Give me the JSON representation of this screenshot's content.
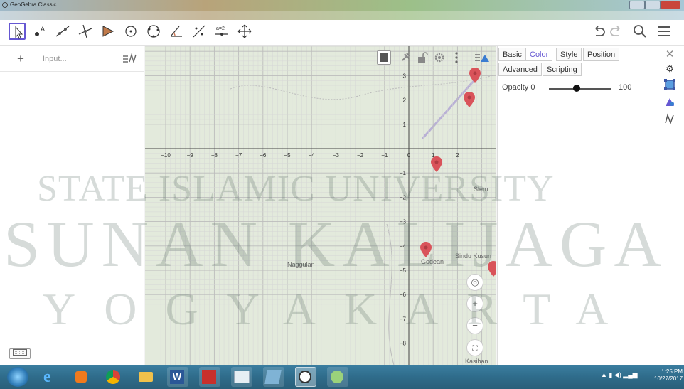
{
  "window": {
    "title": "GeoGebra Classic"
  },
  "toolbar": {
    "tools": [
      "move-tool",
      "point-tool",
      "line-tool",
      "perpendicular-line-tool",
      "polygon-tool",
      "circle-tool",
      "ellipse-tool",
      "angle-tool",
      "reflect-tool",
      "slider-tool",
      "move-graphics-tool"
    ],
    "slider_text": "a=2"
  },
  "algebra": {
    "plus": "+",
    "input_placeholder": "Input..."
  },
  "graphics": {
    "x_ticks": [
      "−10",
      "−9",
      "−8",
      "−7",
      "−6",
      "−5",
      "−4",
      "−3",
      "−2",
      "−1",
      "0",
      "1",
      "2"
    ],
    "y_ticks": [
      "3",
      "2",
      "1",
      "−1",
      "−2",
      "−3",
      "−4",
      "−5",
      "−6",
      "−7",
      "−8"
    ],
    "map_labels": {
      "nanggulan": "Naggulan",
      "godean": "Godean",
      "sindu": "Sindu Kusun",
      "sleman": "Slem",
      "kasihan": "Kasihan"
    },
    "zoom_in": "+",
    "zoom_out": "−"
  },
  "properties": {
    "tabs": [
      "Basic",
      "Color",
      "Style",
      "Position",
      "Advanced",
      "Scripting"
    ],
    "active_tab": "Color",
    "opacity_label": "Opacity",
    "opacity_min": "0",
    "opacity_max": "100",
    "opacity_fraction": 0.45
  },
  "watermark": {
    "line1": "STATE ISLAMIC UNIVERSITY",
    "line2": "SUNAN KALIJAGA",
    "line3": "YOGYAKARTA"
  },
  "taskbar": {
    "time": "1:25 PM",
    "date": "10/27/2017"
  },
  "colors": {
    "accent": "#6557d2",
    "pin": "#d9535a",
    "taskbar": "#2f6c8b"
  }
}
